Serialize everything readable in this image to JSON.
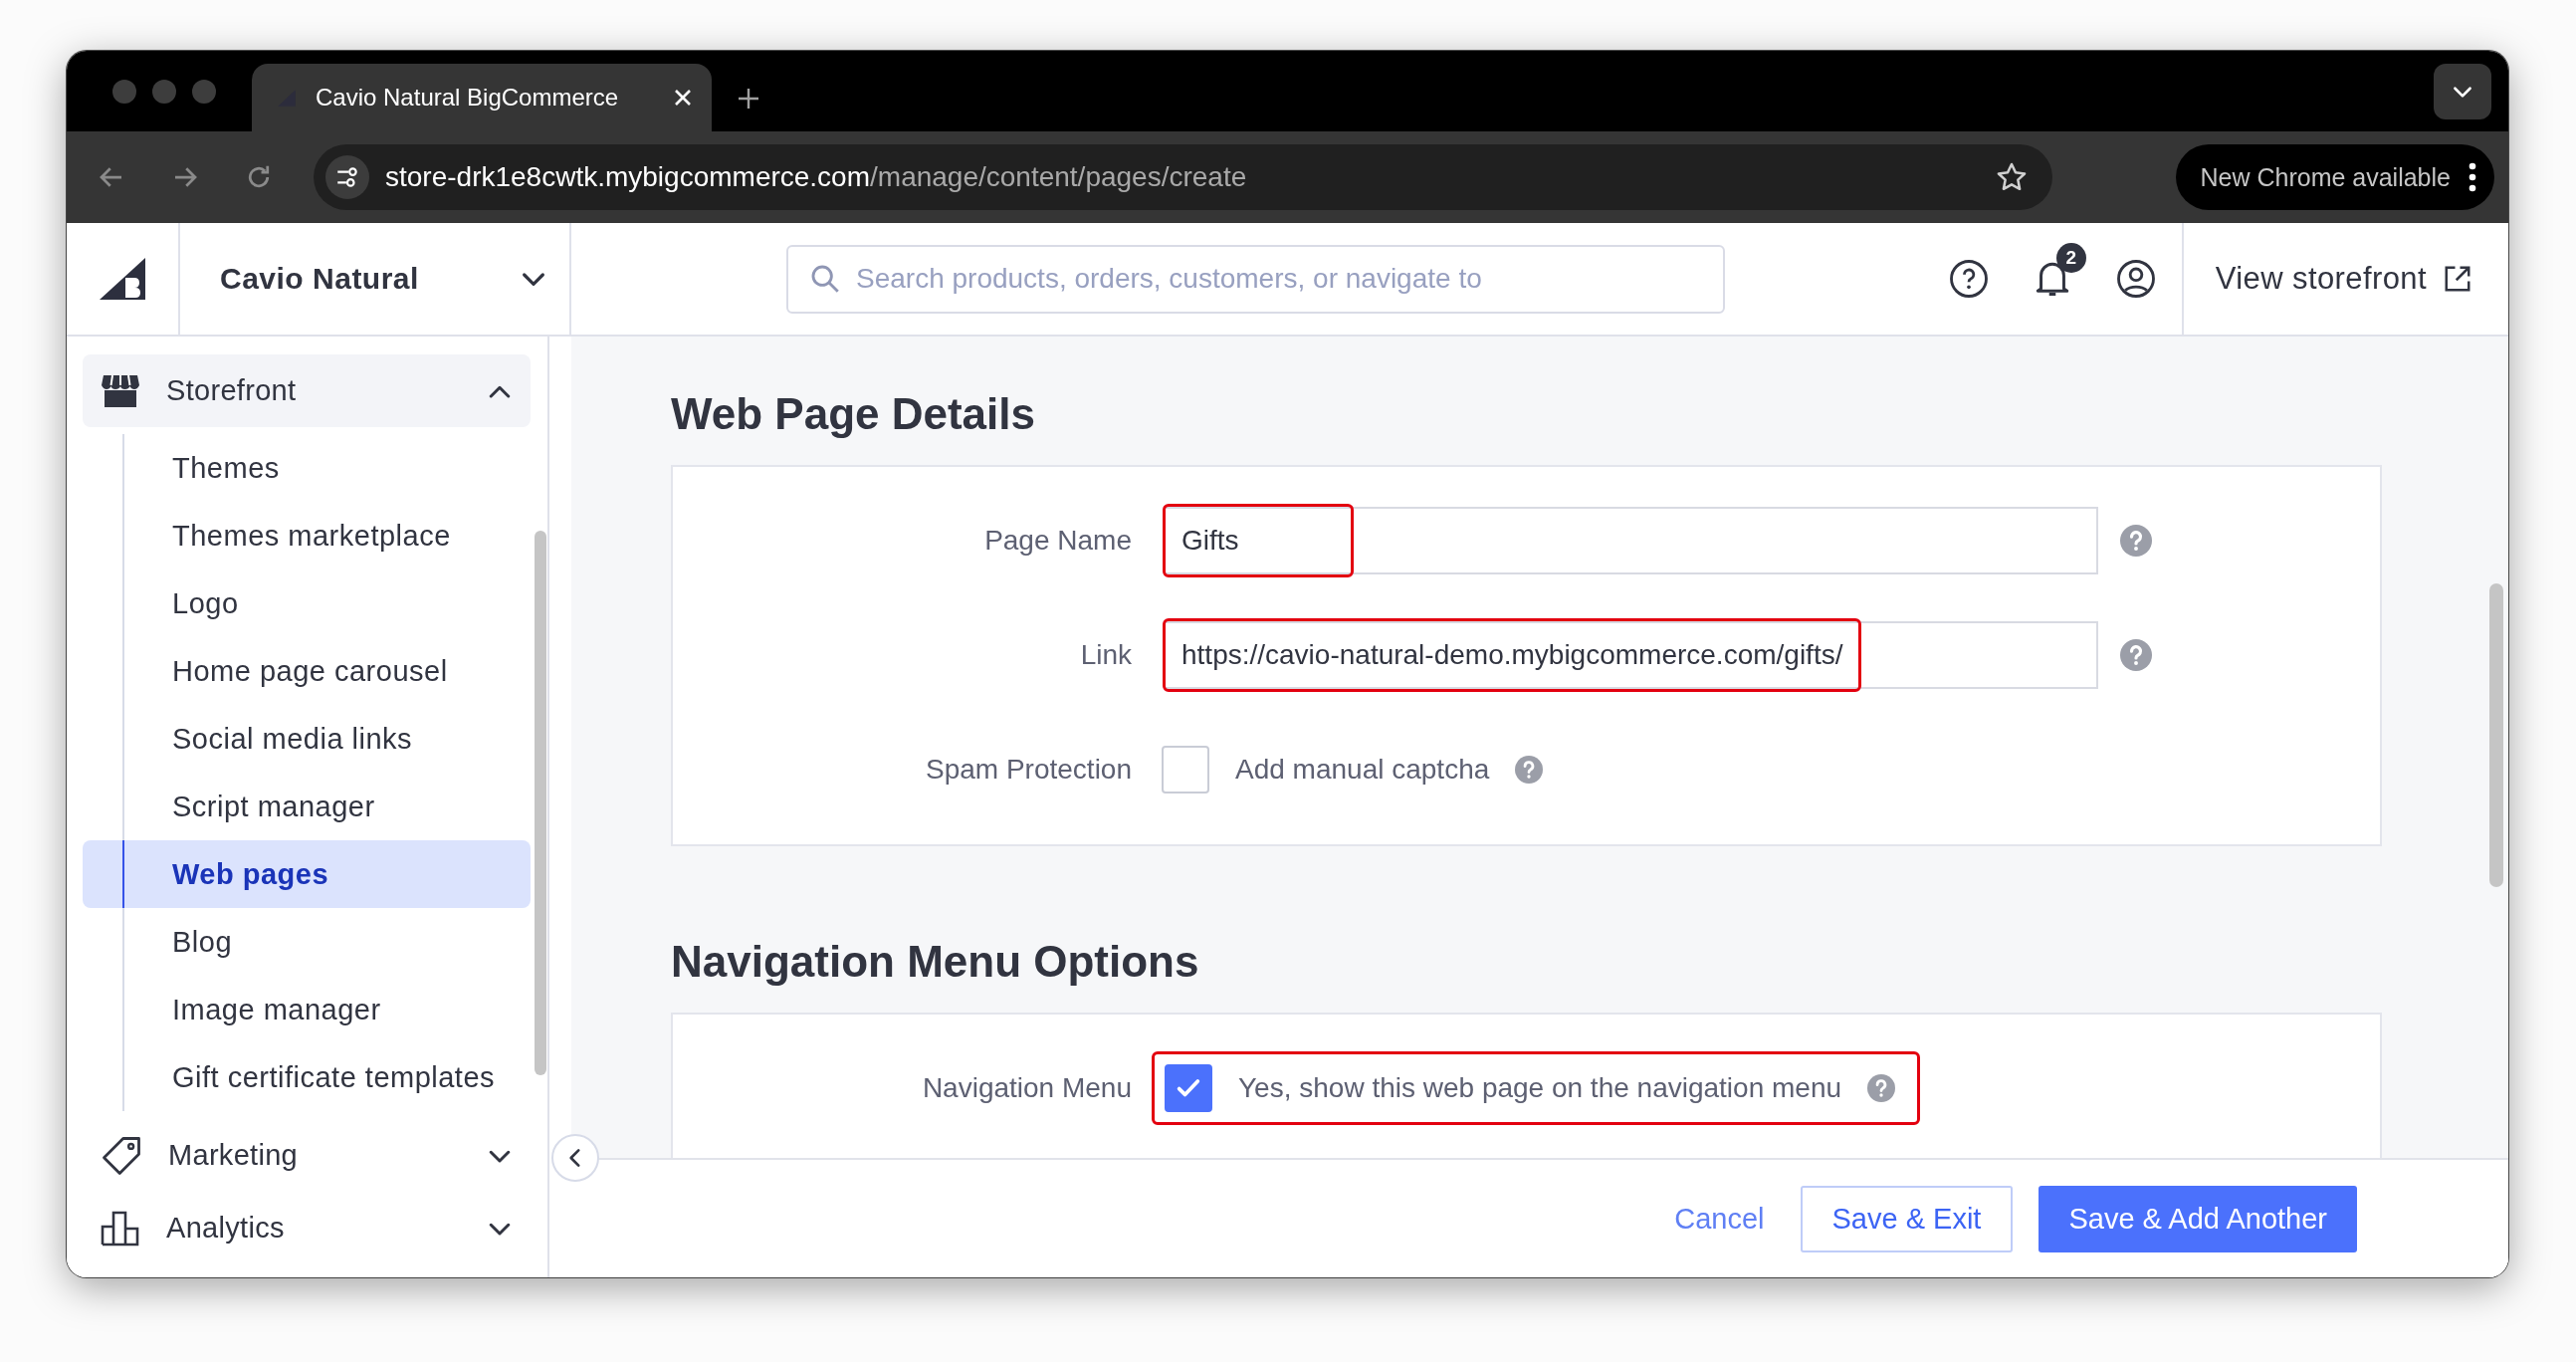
{
  "browser": {
    "tab_title": "Cavio Natural BigCommerce",
    "url_host": "store-drk1e8cwtk.mybigcommerce.com",
    "url_path": "/manage/content/pages/create",
    "update_button": "New Chrome available"
  },
  "header": {
    "store_name": "Cavio Natural",
    "search": {
      "placeholder": "Search products, orders, customers, or navigate to"
    },
    "notification_count": "2",
    "view_storefront": "View storefront"
  },
  "sidebar": {
    "items": [
      {
        "label": "Storefront",
        "expanded": true,
        "children": [
          {
            "label": "Themes",
            "selected": false
          },
          {
            "label": "Themes marketplace",
            "selected": false
          },
          {
            "label": "Logo",
            "selected": false
          },
          {
            "label": "Home page carousel",
            "selected": false
          },
          {
            "label": "Social media links",
            "selected": false
          },
          {
            "label": "Script manager",
            "selected": false
          },
          {
            "label": "Web pages",
            "selected": true
          },
          {
            "label": "Blog",
            "selected": false
          },
          {
            "label": "Image manager",
            "selected": false
          },
          {
            "label": "Gift certificate templates",
            "selected": false
          }
        ]
      },
      {
        "label": "Marketing",
        "expanded": false
      },
      {
        "label": "Analytics",
        "expanded": false
      }
    ]
  },
  "sections": [
    {
      "title": "Web Page Details",
      "fields": [
        {
          "kind": "text",
          "label": "Page Name",
          "value": "Gifts",
          "highlighted": true
        },
        {
          "kind": "text",
          "label": "Link",
          "value": "https://cavio-natural-demo.mybigcommerce.com/gifts/",
          "highlighted": true
        },
        {
          "kind": "checkbox",
          "label": "Spam Protection",
          "option": "Add manual captcha",
          "checked": false,
          "highlighted": false
        }
      ]
    },
    {
      "title": "Navigation Menu Options",
      "fields": [
        {
          "kind": "checkbox",
          "label": "Navigation Menu",
          "option": "Yes, show this web page on the navigation menu",
          "checked": true,
          "highlighted": true
        }
      ]
    }
  ],
  "footer": {
    "buttons": [
      {
        "kind": "link",
        "label": "Cancel"
      },
      {
        "kind": "secondary",
        "label": "Save & Exit"
      },
      {
        "kind": "primary",
        "label": "Save & Add Another"
      }
    ]
  }
}
